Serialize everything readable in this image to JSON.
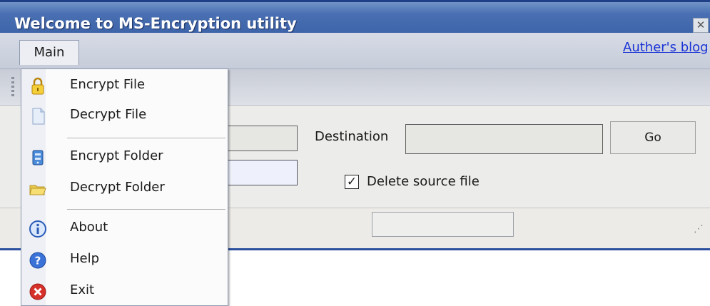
{
  "window": {
    "title": "Welcome to MS-Encryption utility",
    "close_glyph": "✕"
  },
  "menubar": {
    "main_label": "Main",
    "blog_link": "Auther's blog"
  },
  "form": {
    "destination_label": "Destination",
    "go_label": "Go",
    "delete_source_checked": true,
    "delete_source_label": "Delete source file"
  },
  "menu": {
    "items": [
      {
        "label": "Encrypt File",
        "icon": "lock-icon"
      },
      {
        "label": "Decrypt File",
        "icon": "document-icon"
      },
      {
        "label": "Encrypt Folder",
        "icon": "database-icon"
      },
      {
        "label": "Decrypt Folder",
        "icon": "folder-icon"
      },
      {
        "label": "About",
        "icon": "info-icon"
      },
      {
        "label": "Help",
        "icon": "help-icon"
      },
      {
        "label": "Exit",
        "icon": "exit-icon"
      }
    ]
  },
  "colors": {
    "title_bar": "#3c62a8",
    "link": "#1a33d6",
    "menu_border": "#8e99ae"
  }
}
